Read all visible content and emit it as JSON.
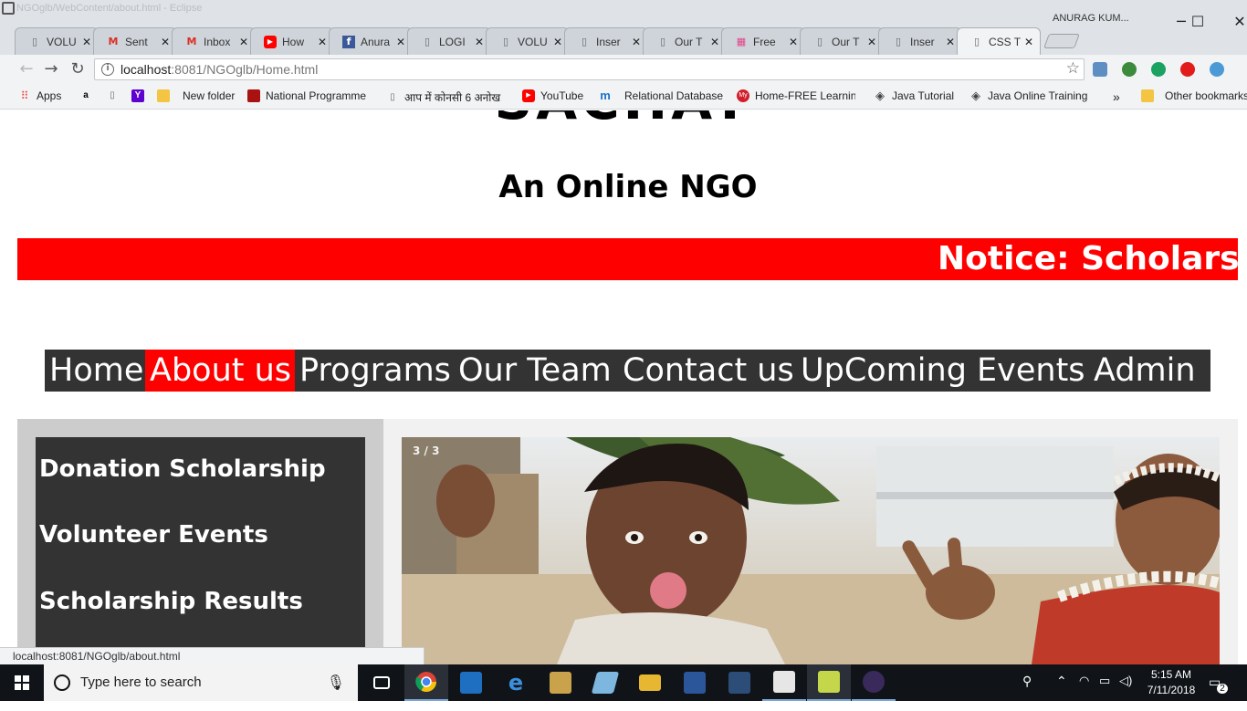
{
  "window": {
    "title": "NGOglb/WebContent/about.html - Eclipse",
    "profile_name": "ANURAG KUM...",
    "minimize": "─",
    "maximize": "☐",
    "close": "✕"
  },
  "tabs": [
    {
      "title": "VOLU",
      "icon": "page-icon"
    },
    {
      "title": "Sent",
      "icon": "gmail-icon"
    },
    {
      "title": "Inbox",
      "icon": "gmail-icon"
    },
    {
      "title": "How",
      "icon": "youtube-icon"
    },
    {
      "title": "Anura",
      "icon": "facebook-icon"
    },
    {
      "title": "LOGI",
      "icon": "page-icon"
    },
    {
      "title": "VOLU",
      "icon": "page-icon"
    },
    {
      "title": "Inser",
      "icon": "page-icon"
    },
    {
      "title": "Our T",
      "icon": "page-icon"
    },
    {
      "title": "Free",
      "icon": "freecss-icon"
    },
    {
      "title": "Our T",
      "icon": "page-icon"
    },
    {
      "title": "Inser",
      "icon": "page-icon"
    },
    {
      "title": "CSS T",
      "icon": "page-icon"
    }
  ],
  "tab_close": "✕",
  "toolbar": {
    "back": "←",
    "forward": "→",
    "reload": "↻",
    "url_host": "localhost",
    "url_rest": ":8081/NGOglb/Home.html",
    "info_glyph": "i",
    "star": "☆"
  },
  "bookmarks": {
    "apps": "Apps",
    "items": [
      "New folder",
      "National Programme",
      "आप में कोनसी 6 अनोख",
      "YouTube",
      "Relational Database",
      "Home-FREE Learning",
      "Java Tutorial",
      "Java Online Training"
    ],
    "more": "»",
    "other": "Other bookmarks"
  },
  "page": {
    "logo_text": "SACHAY",
    "tagline": "An Online NGO",
    "notice": "Notice: Scholarship",
    "nav": [
      "Home",
      "About us",
      "Programs",
      "Our Team",
      "Contact us",
      "UpComing Events",
      " Admin"
    ],
    "active_nav": "About us",
    "sidebar_links": [
      "Donation Scholarship",
      "Volunteer Events",
      "Scholarship Results"
    ],
    "slide_counter": "3 / 3"
  },
  "status_url": "localhost:8081/NGOglb/about.html",
  "taskbar": {
    "search_placeholder": "Type here to search",
    "time": "5:15 AM",
    "date": "7/11/2018",
    "notifications": "2"
  },
  "colors": {
    "accent_red": "#ff0000",
    "nav_dark": "#333333",
    "sidebar_bg": "#cccccc"
  }
}
